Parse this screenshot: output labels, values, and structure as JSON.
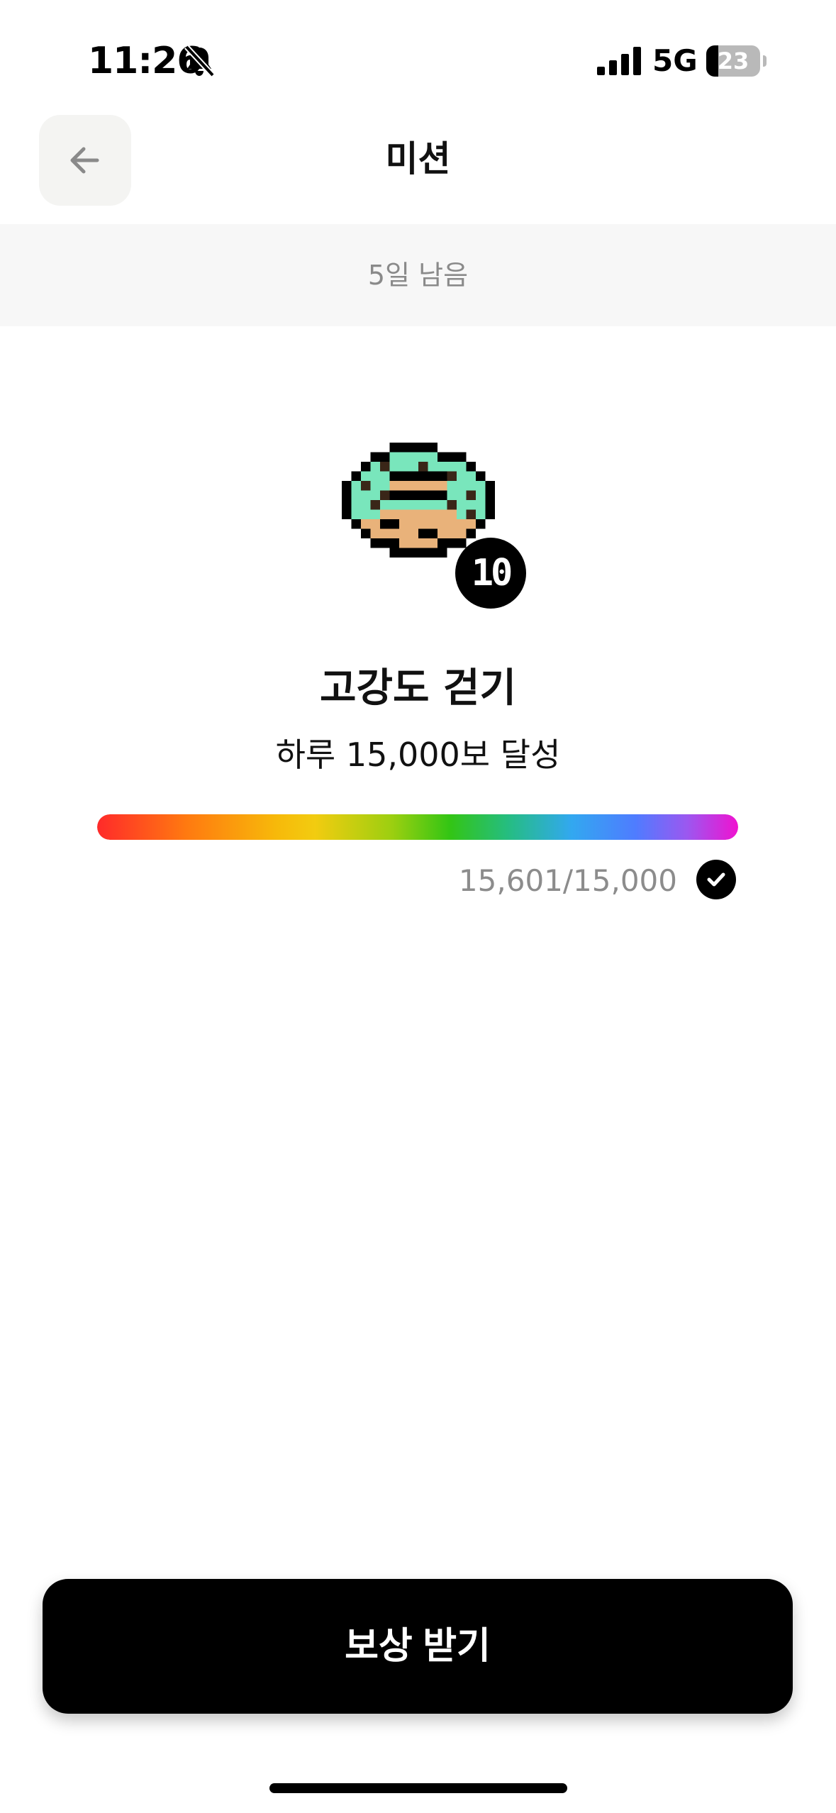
{
  "status_bar": {
    "time": "11:26",
    "network": "5G",
    "battery_level": "23",
    "icons": [
      "bell-slash-icon",
      "cellular-signal-icon",
      "battery-icon"
    ]
  },
  "header": {
    "title": "미션",
    "back_icon": "arrow-left-icon"
  },
  "banner": {
    "remaining": "5일 남음"
  },
  "mission": {
    "image": "pixel-donut-mint",
    "level": "10",
    "title": "고강도 걷기",
    "description": "하루 15,000보 달성",
    "progress": {
      "current_text": "15,601/15,000",
      "fraction": 1.0,
      "completed": true,
      "check_icon": "check-circle-icon"
    }
  },
  "actions": {
    "claim_label": "보상 받기"
  },
  "colors": {
    "accent_mint": "#79e6bc",
    "dough": "#e9b27a",
    "sprinkle": "#3a2618",
    "banner_bg": "#f7f7f7",
    "cta_bg": "#000000",
    "progress_gradient": [
      "#ff2a2a",
      "#ff7a10",
      "#f2cc10",
      "#33c514",
      "#32a8f0",
      "#4f7cff",
      "#f012d0"
    ]
  }
}
